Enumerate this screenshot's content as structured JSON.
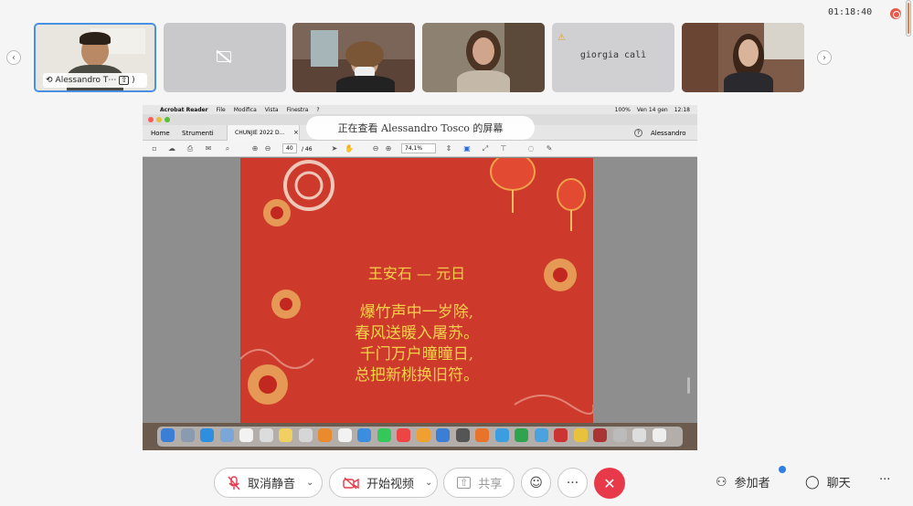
{
  "header": {
    "timer": "01:18:40"
  },
  "participants": [
    {
      "name": "Alessandro T⋯",
      "name_suffix": ")",
      "active": true,
      "video": true
    },
    {
      "name": "",
      "video": false,
      "camera_off": true
    },
    {
      "name": "",
      "video": true
    },
    {
      "name": "",
      "video": true
    },
    {
      "name": "giorgia calì",
      "video": false,
      "warning": true
    },
    {
      "name": "",
      "video": true
    }
  ],
  "banner": {
    "text": "正在查看 Alessandro Tosco 的屏幕"
  },
  "shared_screen": {
    "menubar": {
      "app": "Acrobat Reader",
      "items": [
        "File",
        "Modifica",
        "Vista",
        "Finestra",
        "?"
      ],
      "status": [
        "100%",
        "Ven 14 gen",
        "12:18"
      ]
    },
    "tabs": {
      "home": "Home",
      "tools": "Strumenti",
      "document": "CHUNJIE 2022 D...",
      "close": "×",
      "user": "Alessandro"
    },
    "toolbar": {
      "page_current": "40",
      "page_total": "/ 46",
      "zoom": "74,1%"
    },
    "document": {
      "title": "王安石  —  元日",
      "lines": [
        "爆竹声中一岁除,",
        "春风送暖入屠苏。",
        "千门万户曈曈日,",
        "总把新桃换旧符。"
      ]
    }
  },
  "controls": {
    "mute": "取消静音",
    "video": "开始视频",
    "share": "共享",
    "participants": "参加者",
    "chat": "聊天",
    "more": "···",
    "right_more": "···"
  },
  "colors": {
    "end_call": "#e8394a",
    "accent": "#4a90e2",
    "poster": "#cd3a2c",
    "poem_text": "#f7d14a"
  }
}
